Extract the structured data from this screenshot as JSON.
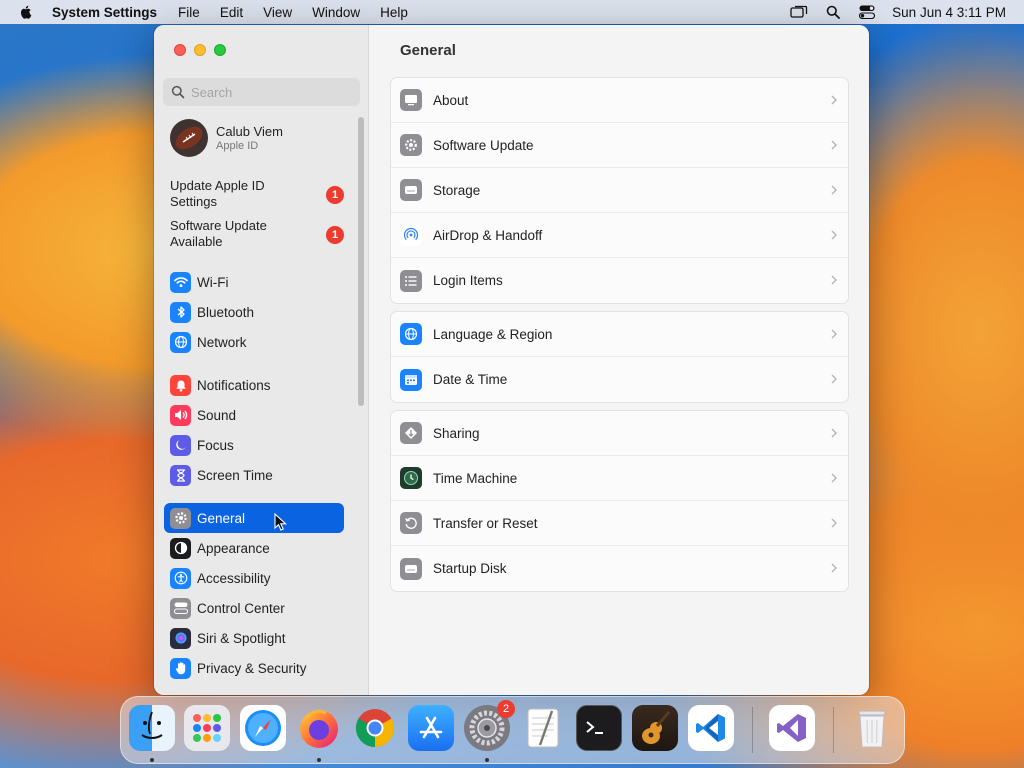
{
  "menubar": {
    "app_name": "System Settings",
    "menus": [
      "File",
      "Edit",
      "View",
      "Window",
      "Help"
    ],
    "clock": "Sun Jun 4  3:11 PM"
  },
  "sidebar": {
    "search_placeholder": "Search",
    "profile": {
      "name": "Calub Viem",
      "subtitle": "Apple ID"
    },
    "notices": [
      {
        "label": "Update Apple ID Settings",
        "badge": "1"
      },
      {
        "label": "Software Update Available",
        "badge": "1"
      }
    ],
    "items": [
      {
        "label": "Wi-Fi",
        "icon": "wifi-icon",
        "color": "#1a84ff"
      },
      {
        "label": "Bluetooth",
        "icon": "bluetooth-icon",
        "color": "#1a84ff"
      },
      {
        "label": "Network",
        "icon": "globe-icon",
        "color": "#1a84ff"
      },
      {
        "label": "Notifications",
        "icon": "bell-icon",
        "color": "#ff453a"
      },
      {
        "label": "Sound",
        "icon": "speaker-icon",
        "color": "#ff3b5c"
      },
      {
        "label": "Focus",
        "icon": "moon-icon",
        "color": "#5e5ce6"
      },
      {
        "label": "Screen Time",
        "icon": "hourglass-icon",
        "color": "#5e5ce6"
      },
      {
        "label": "General",
        "icon": "gear-icon",
        "color": "#8e8e93",
        "selected": true
      },
      {
        "label": "Appearance",
        "icon": "appearance-icon",
        "color": "#1c1c1e"
      },
      {
        "label": "Accessibility",
        "icon": "accessibility-icon",
        "color": "#1a84ff"
      },
      {
        "label": "Control Center",
        "icon": "control-center-icon",
        "color": "#8e8e93"
      },
      {
        "label": "Siri & Spotlight",
        "icon": "siri-icon",
        "color": "#2b2b40"
      },
      {
        "label": "Privacy & Security",
        "icon": "hand-icon",
        "color": "#1a84ff"
      }
    ]
  },
  "main": {
    "title": "General",
    "groups": [
      [
        {
          "label": "About",
          "icon": "display-icon"
        },
        {
          "label": "Software Update",
          "icon": "gear-badge-icon"
        },
        {
          "label": "Storage",
          "icon": "drive-icon"
        },
        {
          "label": "AirDrop & Handoff",
          "icon": "airdrop-icon"
        },
        {
          "label": "Login Items",
          "icon": "list-icon"
        }
      ],
      [
        {
          "label": "Language & Region",
          "icon": "globe-icon"
        },
        {
          "label": "Date & Time",
          "icon": "calendar-icon"
        }
      ],
      [
        {
          "label": "Sharing",
          "icon": "sharing-icon"
        },
        {
          "label": "Time Machine",
          "icon": "time-machine-icon"
        },
        {
          "label": "Transfer or Reset",
          "icon": "reset-icon"
        },
        {
          "label": "Startup Disk",
          "icon": "drive-icon"
        }
      ]
    ]
  },
  "dock": {
    "apps": [
      "finder-icon",
      "launchpad-icon",
      "safari-icon",
      "firefox-icon",
      "chrome-icon",
      "app-store-icon",
      "system-settings-icon",
      "textedit-icon",
      "terminal-icon",
      "garageband-icon",
      "vscode-icon",
      "visual-studio-icon",
      "trash-icon"
    ],
    "settings_badge": "2"
  }
}
